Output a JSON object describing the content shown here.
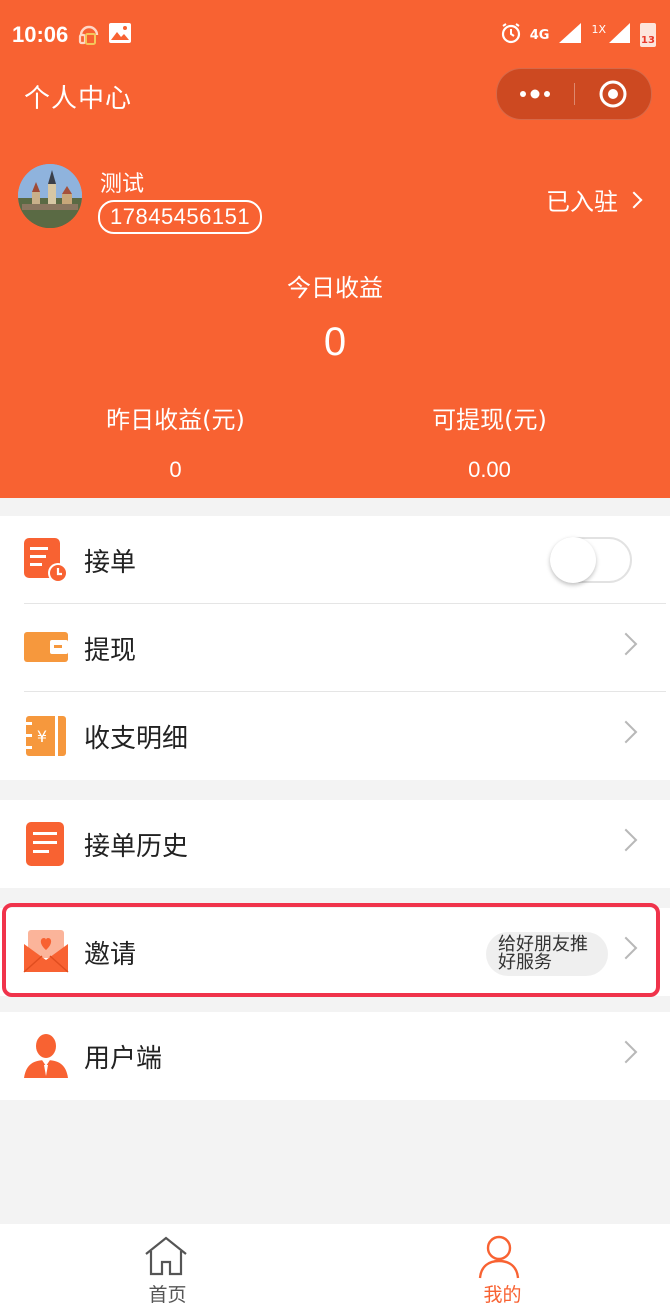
{
  "status_bar": {
    "time": "10:06",
    "network_label": "4G",
    "sim_label": "1X",
    "battery_label": "13"
  },
  "header": {
    "title": "个人中心",
    "capsule_more_icon": "more-dots-icon",
    "capsule_close_icon": "circle-target-icon"
  },
  "profile": {
    "name": "测试",
    "phone": "17845456151",
    "settled_label": "已入驻"
  },
  "earnings": {
    "today_label": "今日收益",
    "today_value": "0",
    "yesterday_label": "昨日收益(元)",
    "yesterday_value": "0",
    "withdrawable_label": "可提现(元)",
    "withdrawable_value": "0.00"
  },
  "menu": {
    "accept_orders": "接单",
    "withdraw": "提现",
    "income_details": "收支明细",
    "order_history": "接单历史",
    "invite": "邀请",
    "invite_hint": "给好朋友推好服务",
    "user_side": "用户端"
  },
  "tabbar": {
    "home": "首页",
    "mine": "我的"
  },
  "colors": {
    "brand": "#f86232",
    "highlight": "#f0334b",
    "icon_orange": "#f6983d"
  }
}
